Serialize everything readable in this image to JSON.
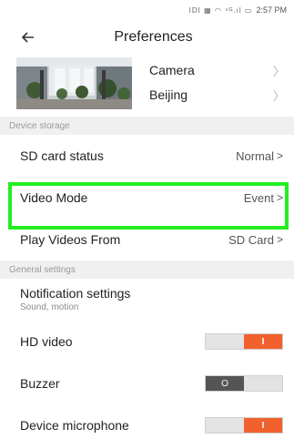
{
  "status_bar": {
    "time": "2:57 PM",
    "icons": "IDI ▦ ◠ ⁴ᴳ.ıl ▭"
  },
  "header": {
    "title": "Preferences",
    "back_icon": "arrow-left-icon"
  },
  "camera": {
    "name": "Camera",
    "location": "Beijing"
  },
  "sections": {
    "device_storage": "Device storage",
    "general_settings": "General settings"
  },
  "storage": {
    "sd_card_status_label": "SD card status",
    "sd_card_status_value": "Normal",
    "video_mode_label": "Video Mode",
    "video_mode_value": "Event",
    "play_videos_label": "Play Videos From",
    "play_videos_value": "SD Card"
  },
  "general": {
    "notification_title": "Notification settings",
    "notification_sub": "Sound, motion",
    "hd_video_label": "HD video",
    "hd_video_state": "I",
    "buzzer_label": "Buzzer",
    "buzzer_state": "O",
    "mic_label": "Device microphone",
    "mic_state": "I"
  },
  "colors": {
    "toggle_on": "#f2612d",
    "highlight": "#22ee22",
    "section_bg": "#f0f0f0"
  }
}
